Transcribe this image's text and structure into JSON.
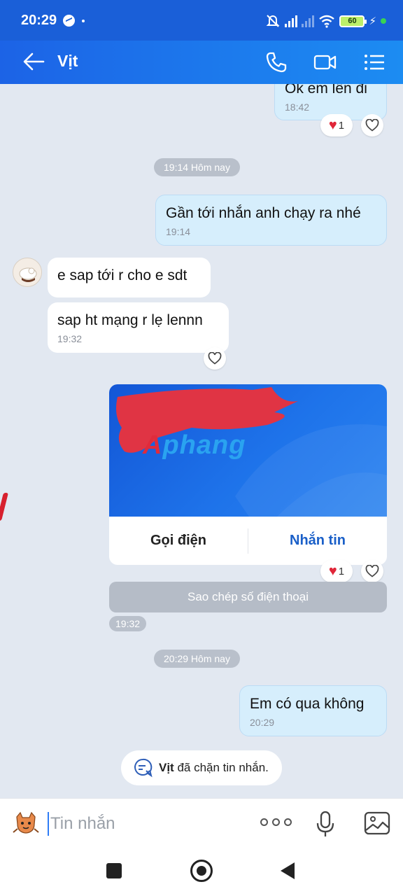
{
  "status_bar": {
    "time": "20:29",
    "battery": "60"
  },
  "header": {
    "title": "Vịt",
    "icons": [
      "back-arrow-icon",
      "phone-icon",
      "video-call-icon",
      "menu-icon"
    ]
  },
  "messages": [
    {
      "from": "me",
      "text": "Ok em lên đi",
      "time": "18:42",
      "reaction_count": "1"
    },
    {
      "type": "date",
      "text": "19:14 Hôm nay"
    },
    {
      "from": "me",
      "text": "Gần tới nhắn anh chạy ra nhé",
      "time": "19:14"
    },
    {
      "from": "them",
      "text": "e sap tới r cho e sdt"
    },
    {
      "from": "them",
      "text": "sap ht mạng r lẹ lennn",
      "time": "19:32"
    },
    {
      "type": "date",
      "text": "20:29 Hôm nay"
    },
    {
      "from": "me",
      "text": "Em có qua không",
      "time": "20:29"
    }
  ],
  "contact_card": {
    "logo_prefix": "A",
    "logo_text": "phang",
    "call_label": "Gọi điện",
    "message_label": "Nhắn tin",
    "reaction_count": "1",
    "copy_label": "Sao chép số điện thoại",
    "time": "19:32"
  },
  "blocked_notice": {
    "name": "Vịt",
    "text": " đã chặn tin nhắn."
  },
  "input_bar": {
    "placeholder": "Tin nhắn"
  },
  "colors": {
    "header_start": "#1c63e6",
    "header_end": "#1c8cf2",
    "bubble_out": "#d6eefc",
    "bubble_in": "#ffffff",
    "link": "#1a5fc8",
    "heart": "#e02638"
  }
}
